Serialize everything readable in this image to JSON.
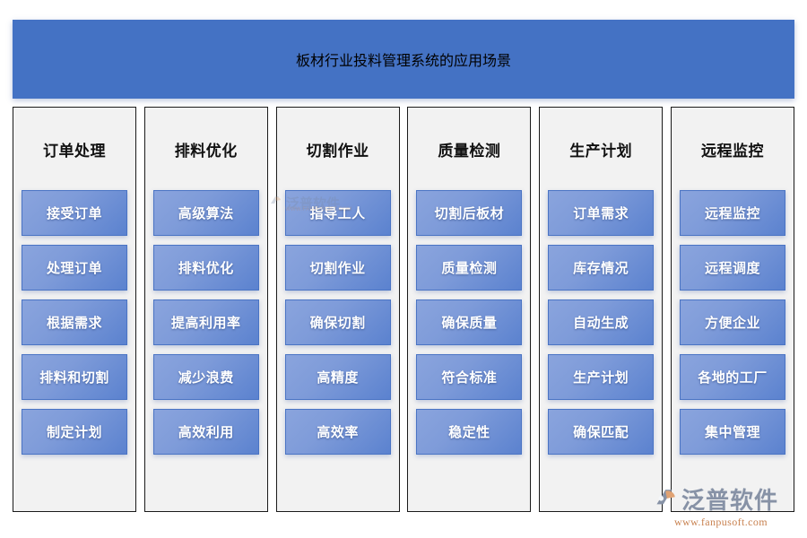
{
  "header": {
    "title": "板材行业投料管理系统的应用场景",
    "background_color": "#4472C4",
    "title_color": "#FFFFFF"
  },
  "theme": {
    "page_background": "#FFFFFF",
    "column_background": "#F2F2F2",
    "column_border_color": "#1A1A1A",
    "card_gradient_from": "#8AA4DD",
    "card_gradient_to": "#5B82CF",
    "card_border_color": "#4A74C4",
    "card_text_color": "#FFFFFF",
    "column_header_text_color": "#111111"
  },
  "columns": [
    {
      "header": "订单处理",
      "cards": [
        "接受订单",
        "处理订单",
        "根据需求",
        "排料和切割",
        "制定计划"
      ]
    },
    {
      "header": "排料优化",
      "cards": [
        "高级算法",
        "排料优化",
        "提高利用率",
        "减少浪费",
        "高效利用"
      ]
    },
    {
      "header": "切割作业",
      "cards": [
        "指导工人",
        "切割作业",
        "确保切割",
        "高精度",
        "高效率"
      ]
    },
    {
      "header": "质量检测",
      "cards": [
        "切割后板材",
        "质量检测",
        "确保质量",
        "符合标准",
        "稳定性"
      ]
    },
    {
      "header": "生产计划",
      "cards": [
        "订单需求",
        "库存情况",
        "自动生成",
        "生产计划",
        "确保匹配"
      ]
    },
    {
      "header": "远程监控",
      "cards": [
        "远程监控",
        "远程调度",
        "方便企业",
        "各地的工厂",
        "集中管理"
      ]
    }
  ],
  "watermark": {
    "name": "泛普软件",
    "url": "WWW.FANPUSOFT.COM"
  },
  "logo": {
    "name": "泛普软件",
    "url": "www.fanpusoft.com",
    "name_color": "#8792A6",
    "url_color": "#C8814F"
  }
}
